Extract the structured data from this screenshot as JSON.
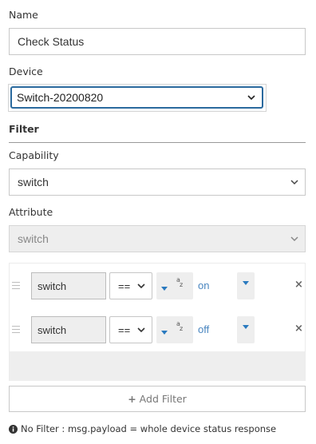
{
  "name": {
    "label": "Name",
    "value": "Check Status"
  },
  "device": {
    "label": "Device",
    "selected": "Switch-20200820"
  },
  "filter": {
    "section_title": "Filter",
    "capability_label": "Capability",
    "capability_value": "switch",
    "attribute_label": "Attribute",
    "attribute_value": "switch",
    "rows": [
      {
        "property": "switch",
        "operator": "==",
        "type_icon": "az-icon",
        "value": "on"
      },
      {
        "property": "switch",
        "operator": "==",
        "type_icon": "az-icon",
        "value": "off"
      }
    ],
    "add_label": "Add Filter",
    "add_icon": "+"
  },
  "info": {
    "icon": "info-icon",
    "text": "No Filter : msg.payload = whole device status response"
  }
}
